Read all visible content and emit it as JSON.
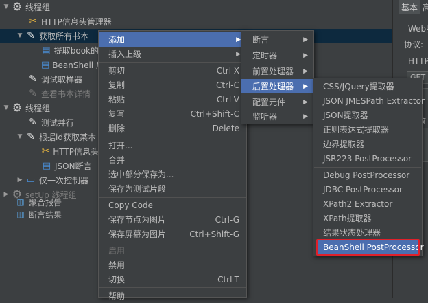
{
  "tree": [
    {
      "label": "线程组",
      "icon": "gear-icon"
    },
    {
      "label": "HTTP信息头管理器",
      "icon": "tools-icon"
    },
    {
      "label": "获取所有书本",
      "icon": "pen-icon"
    },
    {
      "label": "提取book的",
      "icon": "doc-icon"
    },
    {
      "label": "BeanShell 后",
      "icon": "doc-icon"
    },
    {
      "label": "调试取样器",
      "icon": "pen-icon"
    },
    {
      "label": "查看书本详情",
      "icon": "pen-icon"
    },
    {
      "label": "线程组",
      "icon": "gear-icon"
    },
    {
      "label": "测试并行",
      "icon": "pen-icon"
    },
    {
      "label": "根据id获取某本",
      "icon": "pen-icon"
    },
    {
      "label": "HTTP信息头",
      "icon": "tools-icon"
    },
    {
      "label": "JSON断言",
      "icon": "doc-icon"
    },
    {
      "label": "仅一次控制器",
      "icon": "controller-icon"
    },
    {
      "label": "setUp 线程组",
      "icon": "gear-icon"
    },
    {
      "label": "聚合报告",
      "icon": "chart-icon"
    },
    {
      "label": "断言结果",
      "icon": "chart-icon"
    }
  ],
  "right_panel": {
    "tab_basic": "基本",
    "tab_advanced": "高",
    "web_label": "Web服",
    "protocol_label": "协议:",
    "http_label": "HTTP",
    "method_value": "GET",
    "misc_char": "数"
  },
  "context_menu": {
    "items": [
      {
        "label": "添加",
        "shortcut": "",
        "submenu": true,
        "highlighted": true
      },
      {
        "label": "插入上级",
        "shortcut": "",
        "submenu": true
      },
      {
        "label": "剪切",
        "shortcut": "Ctrl-X"
      },
      {
        "label": "复制",
        "shortcut": "Ctrl-C"
      },
      {
        "label": "粘贴",
        "shortcut": "Ctrl-V"
      },
      {
        "label": "复写",
        "shortcut": "Ctrl+Shift-C"
      },
      {
        "label": "删除",
        "shortcut": "Delete"
      },
      {
        "label": "打开..."
      },
      {
        "label": "合并"
      },
      {
        "label": "选中部分保存为..."
      },
      {
        "label": "保存为测试片段"
      },
      {
        "label": "Copy Code"
      },
      {
        "label": "保存节点为图片",
        "shortcut": "Ctrl-G"
      },
      {
        "label": "保存屏幕为图片",
        "shortcut": "Ctrl+Shift-G"
      },
      {
        "label": "启用",
        "disabled": true
      },
      {
        "label": "禁用"
      },
      {
        "label": "切换",
        "shortcut": "Ctrl-T"
      },
      {
        "label": "帮助"
      }
    ]
  },
  "add_submenu": {
    "items": [
      {
        "label": "断言"
      },
      {
        "label": "定时器"
      },
      {
        "label": "前置处理器"
      },
      {
        "label": "后置处理器",
        "highlighted": true
      },
      {
        "label": "配置元件"
      },
      {
        "label": "监听器"
      }
    ]
  },
  "post_processor_submenu": {
    "items": [
      {
        "label": "CSS/JQuery提取器"
      },
      {
        "label": "JSON JMESPath Extractor"
      },
      {
        "label": "JSON提取器"
      },
      {
        "label": "正则表达式提取器"
      },
      {
        "label": "边界提取器"
      },
      {
        "label": "JSR223 PostProcessor"
      },
      {
        "label": "Debug PostProcessor"
      },
      {
        "label": "JDBC PostProcessor"
      },
      {
        "label": "XPath2 Extractor"
      },
      {
        "label": "XPath提取器"
      },
      {
        "label": "结果状态处理器"
      },
      {
        "label": "BeanShell PostProcessor",
        "highlighted": true
      }
    ]
  },
  "colors": {
    "background": "#3c3f41",
    "highlight": "#4b6eaf",
    "selection": "#0d293e",
    "annotation_box": "#e0202a"
  }
}
